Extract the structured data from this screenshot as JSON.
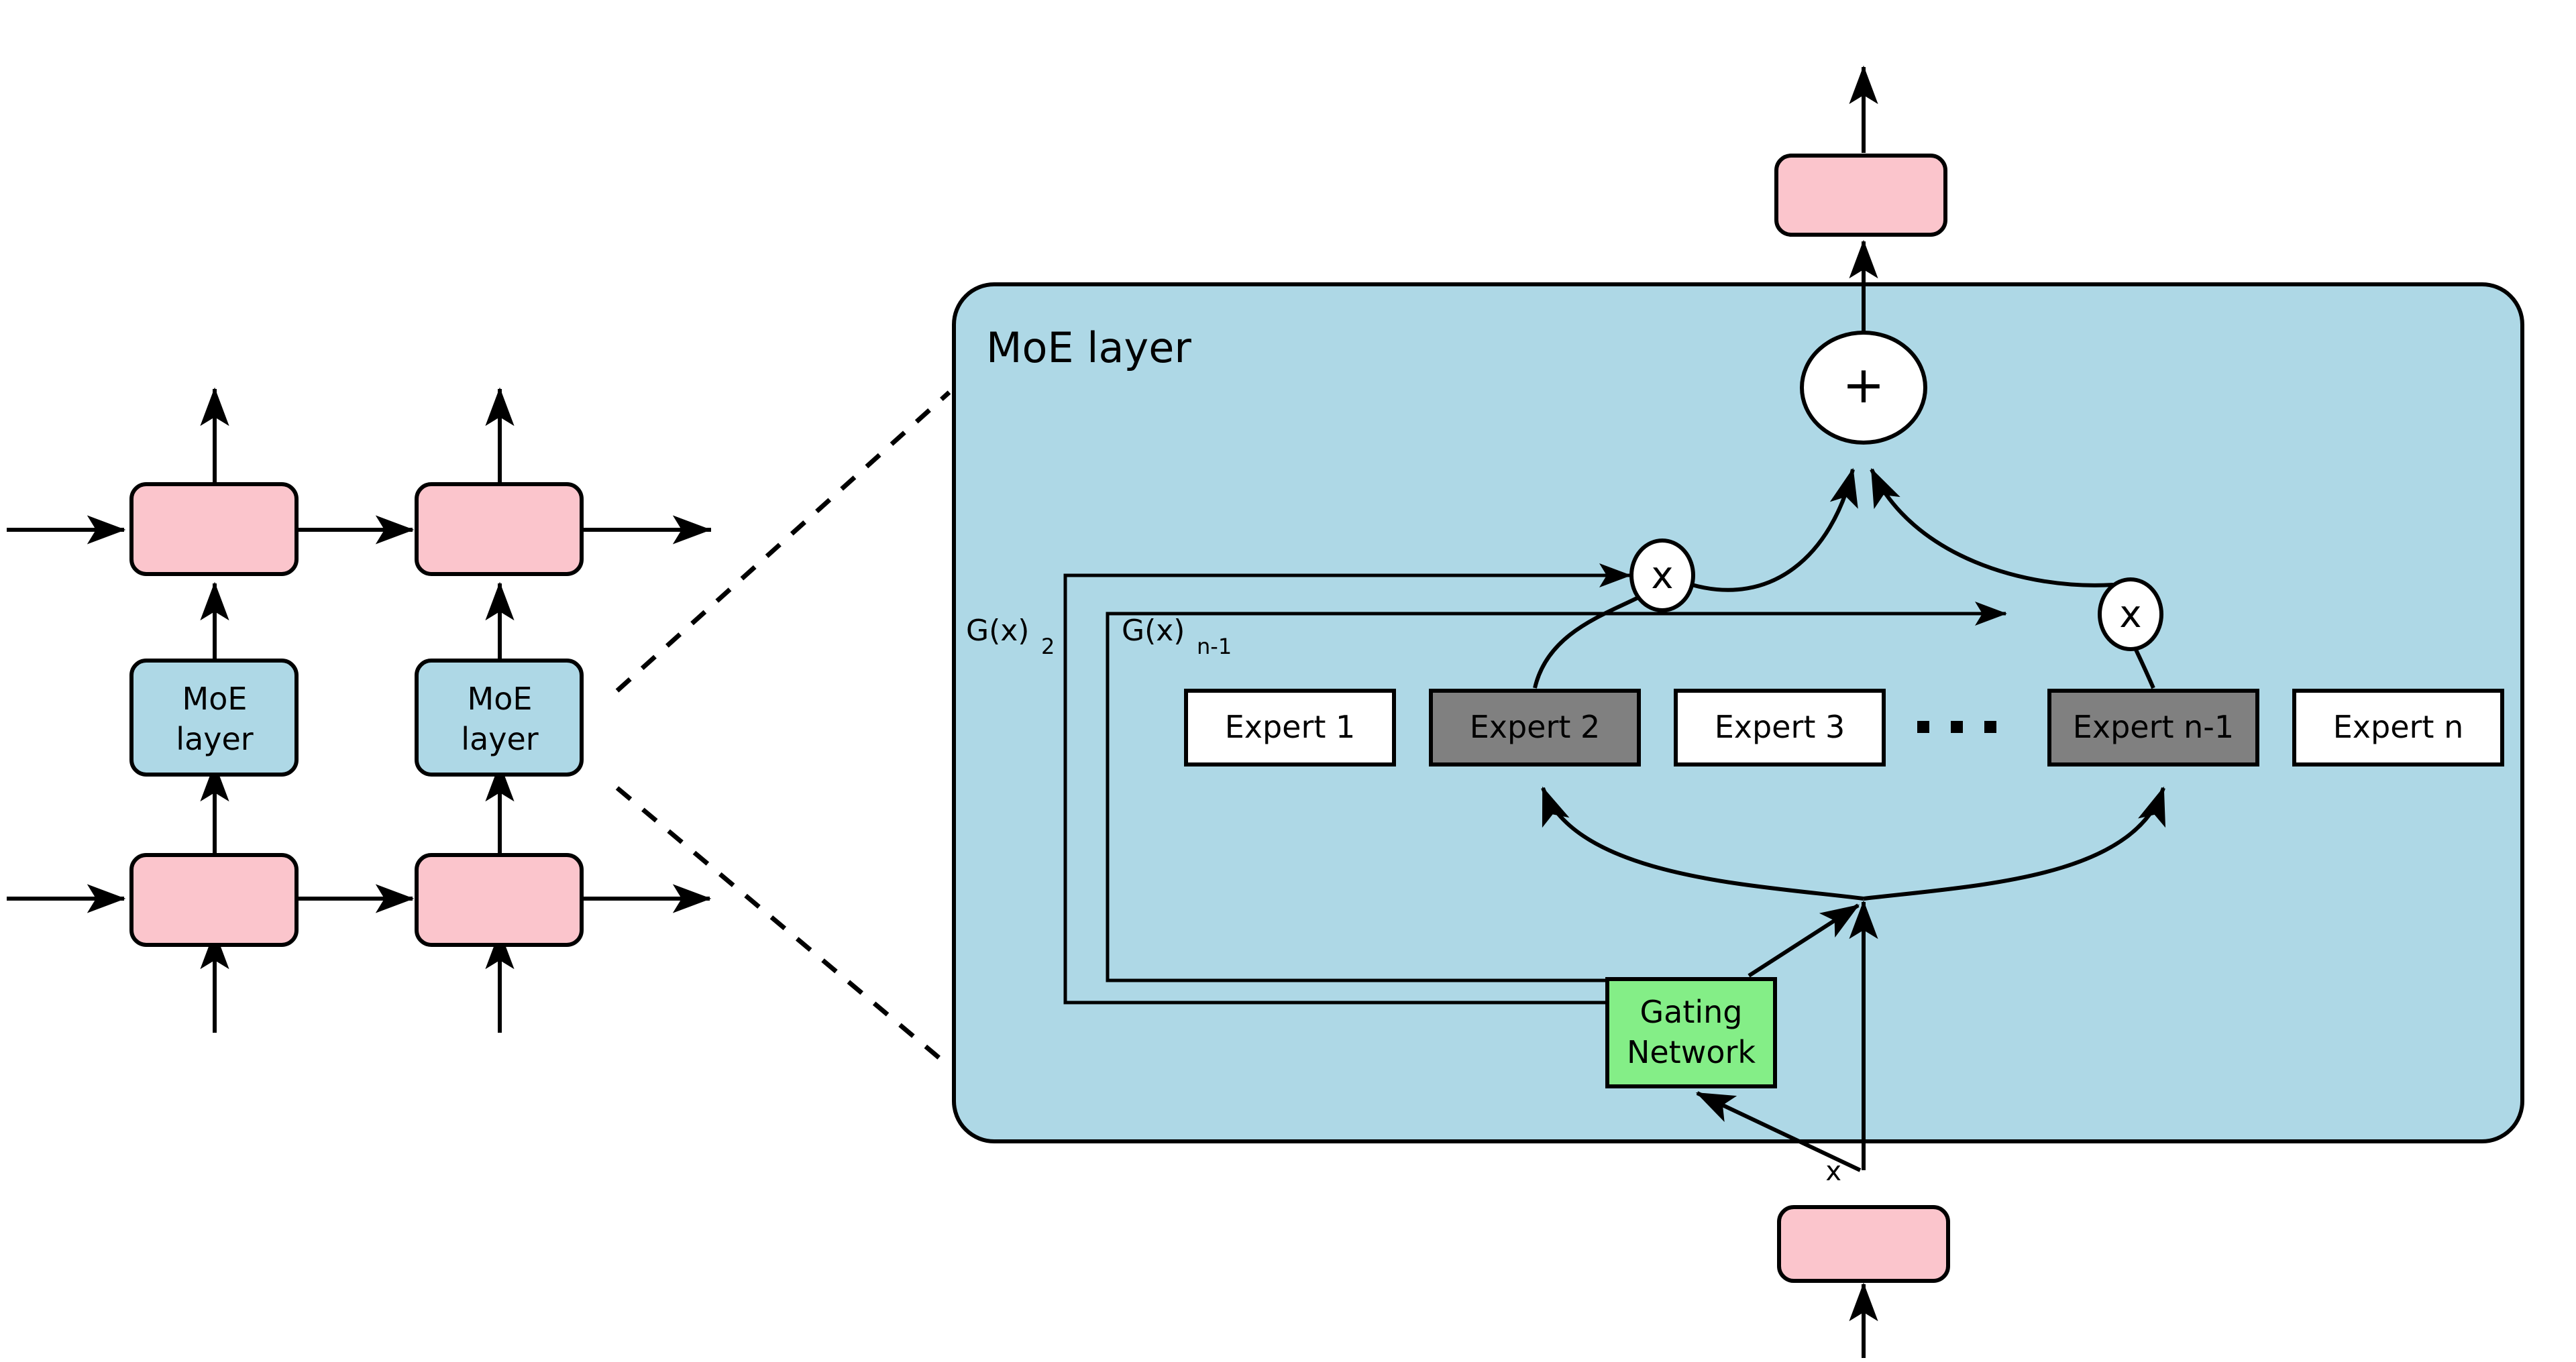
{
  "figure": {
    "type": "diagram",
    "subject": "Mixture-of-Experts (MoE) layer architecture"
  },
  "colors": {
    "pink": "#fbc5cc",
    "blue_panel": "#aed8e6",
    "green": "#84ee87",
    "expert_active": "#808080",
    "expert_inactive": "#ffffff",
    "stroke": "#000000"
  },
  "left_panel": {
    "name": "stacked-layers-overview",
    "moe_blocks": [
      {
        "label_line1": "MoE",
        "label_line2": "layer"
      },
      {
        "label_line1": "MoE",
        "label_line2": "layer"
      }
    ],
    "pink_blocks_count": 4
  },
  "moe_layer": {
    "title": "MoE layer",
    "gate_labels": [
      {
        "base": "G(x)",
        "sub": "2"
      },
      {
        "base": "G(x)",
        "sub": "n-1"
      }
    ],
    "gating_network": {
      "line1": "Gating",
      "line2": "Network"
    },
    "sum_operator": "+",
    "multiply_operators": [
      "x",
      "x"
    ],
    "input_label": "x",
    "ellipsis": "· · ·",
    "experts": [
      {
        "label": "Expert 1",
        "active": false
      },
      {
        "label": "Expert 2",
        "active": true
      },
      {
        "label": "Expert 3",
        "active": false
      },
      {
        "label": "Expert n-1",
        "active": true
      },
      {
        "label": "Expert n",
        "active": false
      }
    ]
  }
}
